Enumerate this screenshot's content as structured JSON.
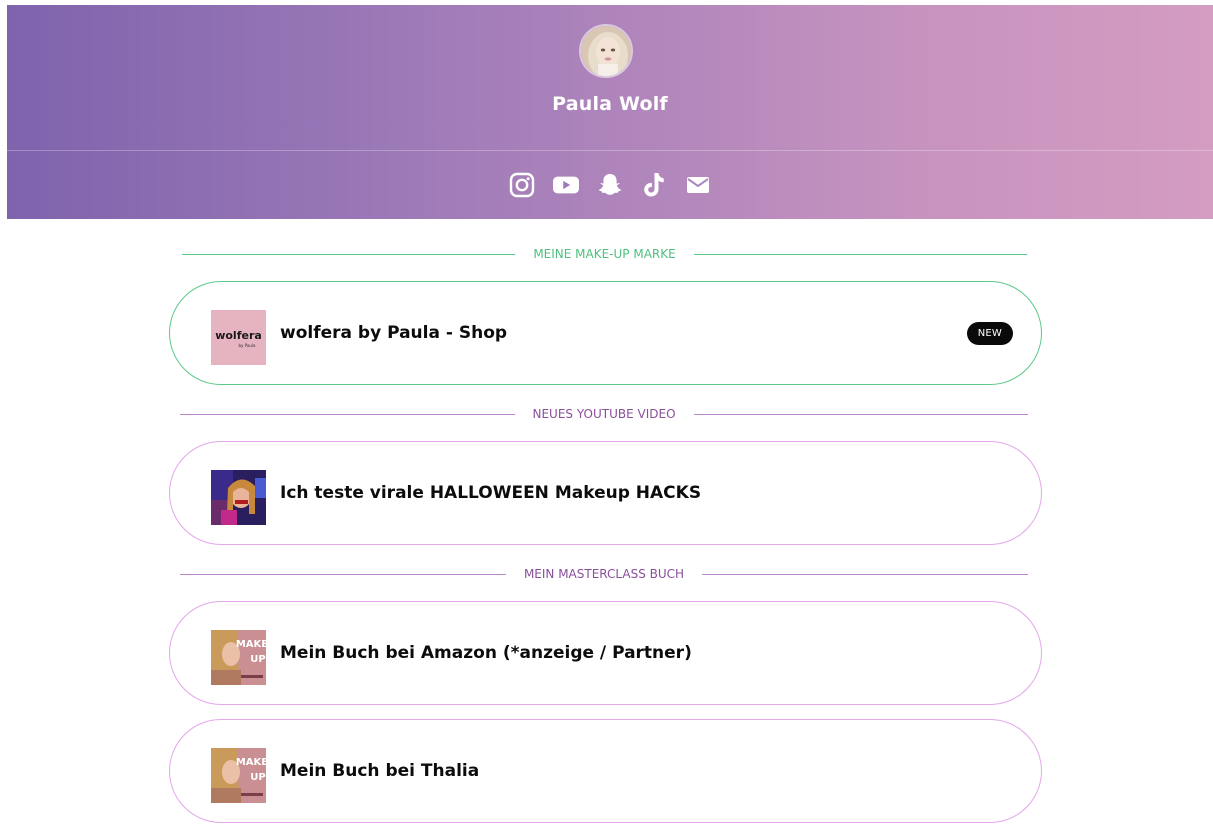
{
  "profile": {
    "name": "Paula Wolf"
  },
  "colors": {
    "header_start": "#7e63ad",
    "header_end": "#d49cc1",
    "green_accent": "#5cc98a",
    "purple_text": "#8a4f9a",
    "purple_line": "#b986c9",
    "pink_border": "#e3a7ea"
  },
  "social_icons": [
    "instagram-icon",
    "youtube-icon",
    "snapchat-icon",
    "tiktok-icon",
    "mail-icon"
  ],
  "sections": [
    {
      "label": "MEINE MAKE-UP MARKE"
    },
    {
      "label": "NEUES YOUTUBE VIDEO"
    },
    {
      "label": "MEIN MASTERCLASS BUCH"
    }
  ],
  "links": [
    {
      "title": "wolfera by Paula - Shop",
      "badge": "NEW",
      "thumb_text": "wolfera",
      "thumb_subtext": "by Paula"
    },
    {
      "title": "Ich teste virale HALLOWEEN Makeup HACKS"
    },
    {
      "title": "Mein Buch bei Amazon (*anzeige / Partner)",
      "thumb_text_top": "MAKE",
      "thumb_text_bottom": "UP"
    },
    {
      "title": "Mein Buch bei Thalia",
      "thumb_text_top": "MAKE",
      "thumb_text_bottom": "UP"
    }
  ]
}
